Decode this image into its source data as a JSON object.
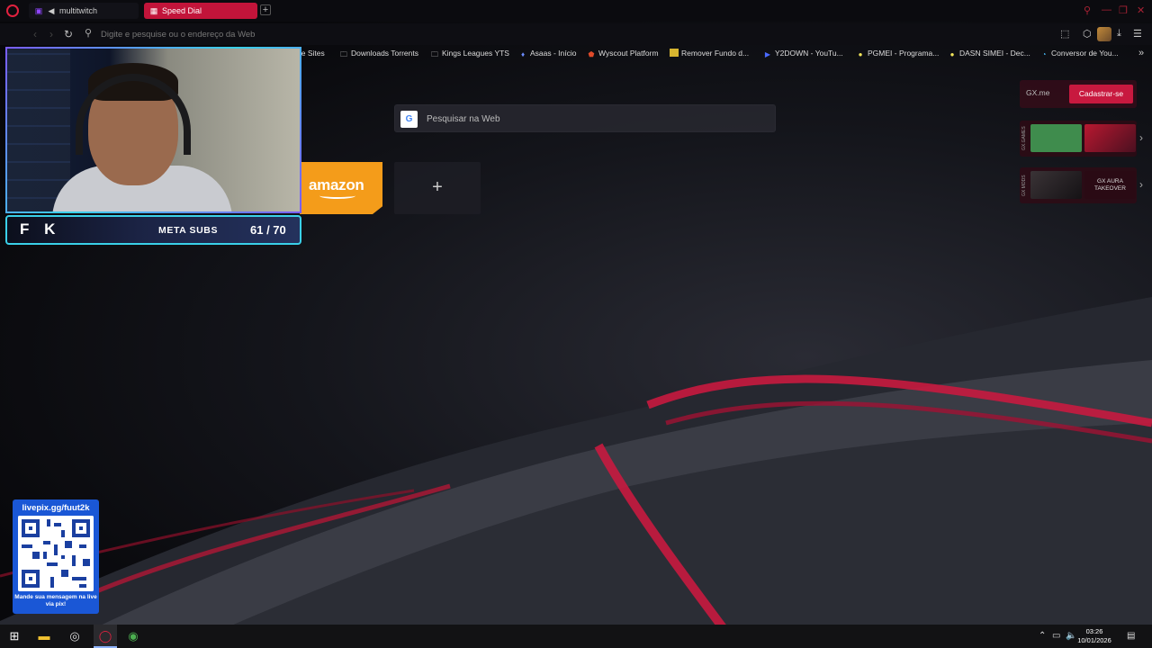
{
  "tabs": [
    {
      "label": "multitwitch",
      "icon": "twitch-icon"
    },
    {
      "label": "Speed Dial",
      "icon": "speed-dial-icon"
    }
  ],
  "address": {
    "placeholder": "Digite e pesquise ou o endereço da Web"
  },
  "bookmarks": [
    {
      "label": "ne Sites",
      "icon": "none"
    },
    {
      "label": "Downloads Torrents",
      "icon": "folder-icon"
    },
    {
      "label": "Kings Leagues YTS",
      "icon": "folder-icon"
    },
    {
      "label": "Asaas - Início",
      "icon": "asaas-icon"
    },
    {
      "label": "Wyscout Platform",
      "icon": "wyscout-icon"
    },
    {
      "label": "Remover Fundo d...",
      "icon": "remove-bg-icon"
    },
    {
      "label": "Y2DOWN - YouTu...",
      "icon": "y2down-icon"
    },
    {
      "label": "PGMEI - Programa...",
      "icon": "pgmei-icon"
    },
    {
      "label": "DASN SIMEI - Dec...",
      "icon": "dasn-icon"
    },
    {
      "label": "Conversor de You...",
      "icon": "converter-icon"
    }
  ],
  "search": {
    "placeholder": "Pesquisar na Web",
    "engine_letter": "G"
  },
  "speed_dial": {
    "amazon_label": "amazon",
    "add_symbol": "+"
  },
  "gx": {
    "gxme": "GX.me",
    "signup": "Cadastrar-se",
    "card1_tag": "GX.GAMES",
    "card2_tag": "GX MODS",
    "card2_text": "GX AURA TAKEOVER"
  },
  "stream": {
    "logo": "F K",
    "meta_label": "META SUBS",
    "meta_count": "61 / 70"
  },
  "qr": {
    "link": "livepix.gg/fuut2k",
    "caption": "Mande sua mensagem na live via pix!"
  },
  "taskbar": {
    "time": "03:26",
    "date": "10/01/2026"
  },
  "colors": {
    "accent": "#c8193f",
    "opera_red": "#e0213f",
    "amazon": "#f49c1a",
    "cam_border": "#3ad0e8",
    "qr_bg": "#1a57d6"
  }
}
